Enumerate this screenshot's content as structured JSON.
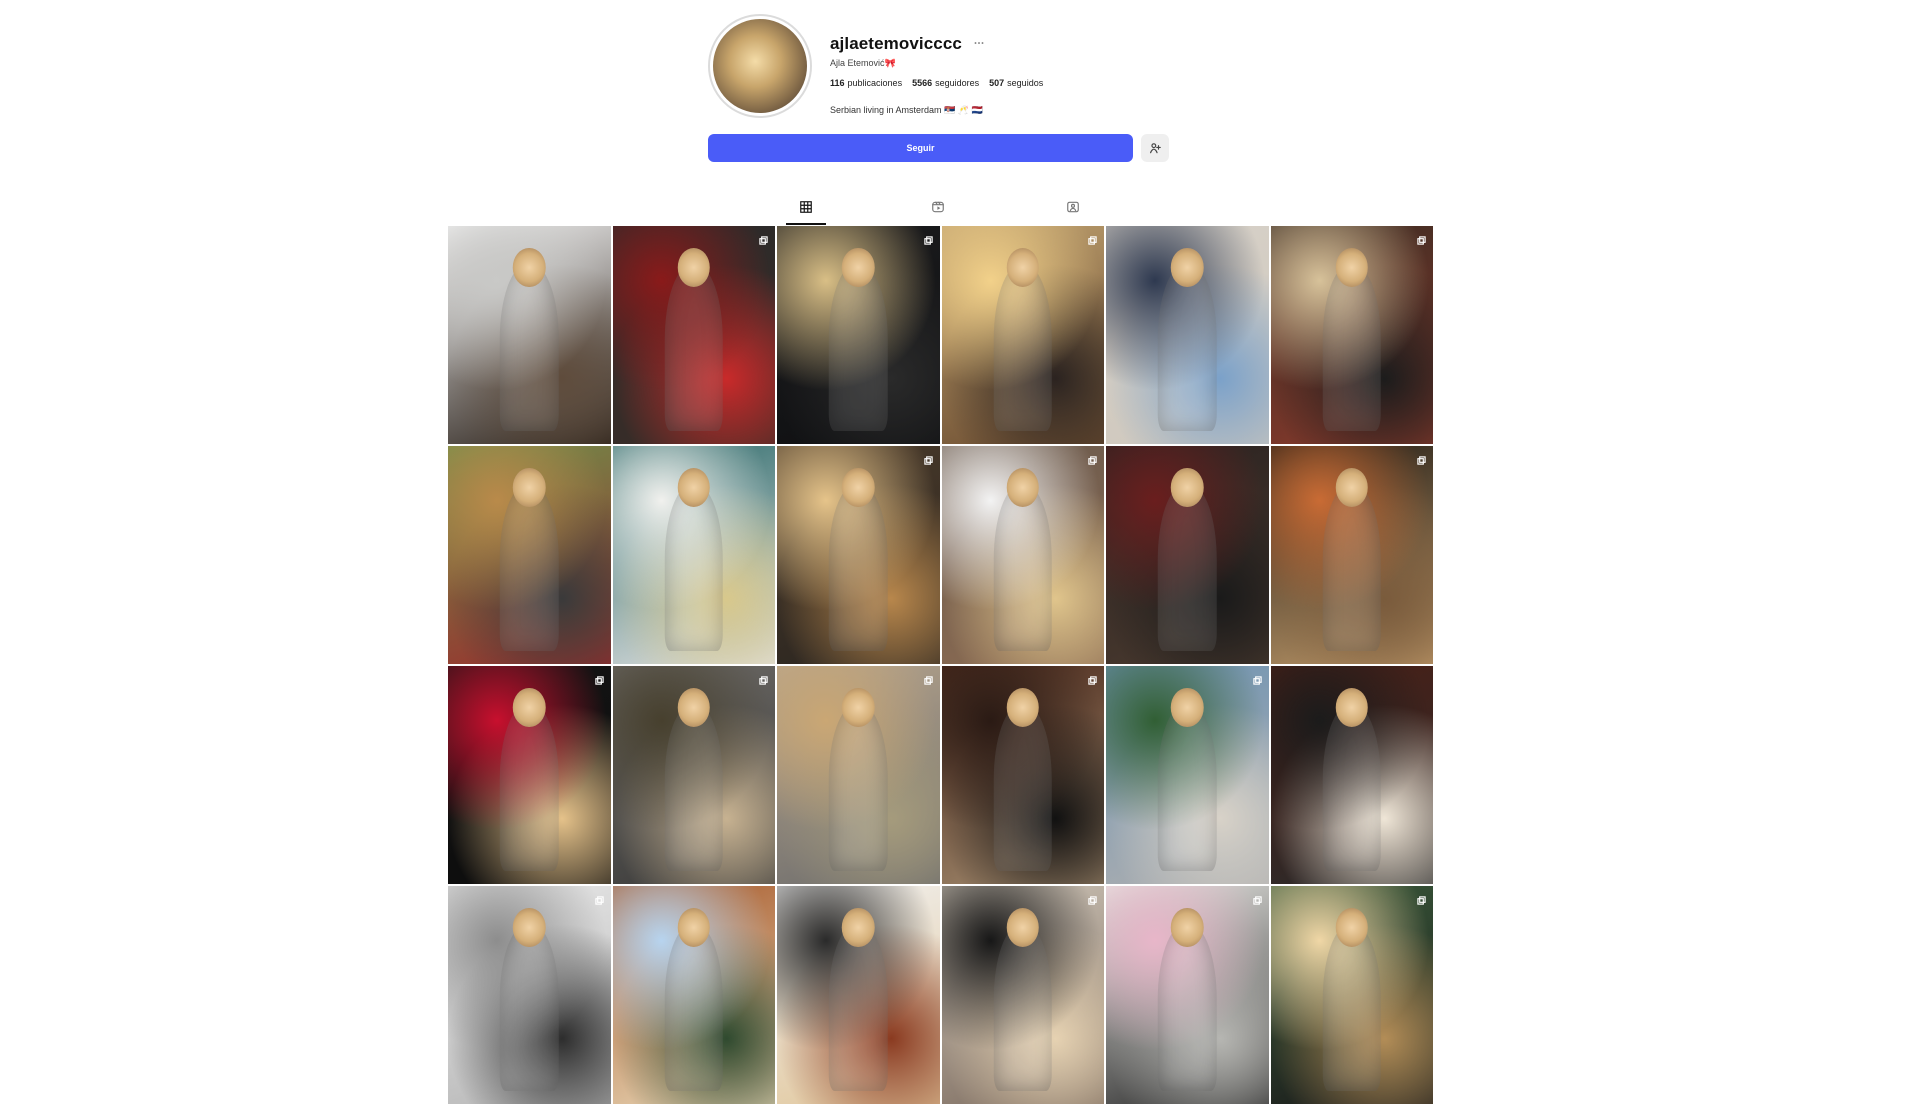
{
  "profile": {
    "username": "ajlaetemovicccc",
    "full_name": "Ajla Etemović🎀",
    "stats": [
      {
        "value": "116",
        "label": "publicaciones"
      },
      {
        "value": "5566",
        "label": "seguidores"
      },
      {
        "value": "507",
        "label": "seguidos"
      }
    ],
    "bio": "Serbian living in Amsterdam 🇷🇸 🥂 🇳🇱",
    "follow_button": "Seguir",
    "more_icon": "ellipsis-icon",
    "suggest_icon": "add-person-icon"
  },
  "tabs": [
    {
      "name": "posts",
      "icon": "grid-icon",
      "active": true
    },
    {
      "name": "reels",
      "icon": "reels-icon",
      "active": false
    },
    {
      "name": "tagged",
      "icon": "tagged-icon",
      "active": false
    }
  ],
  "grid": {
    "posts": [
      {
        "multi": false,
        "colors": [
          "#f2f2f2",
          "#c9c9c7",
          "#5f4c3c",
          "#2a211a"
        ]
      },
      {
        "multi": true,
        "colors": [
          "#2a2a2a",
          "#8a1a1a",
          "#c92a2a",
          "#3a2d27"
        ]
      },
      {
        "multi": true,
        "colors": [
          "#1b1b1d",
          "#d9bf86",
          "#2a2a2a",
          "#0f1012"
        ]
      },
      {
        "multi": true,
        "colors": [
          "#c0a270",
          "#f2d18a",
          "#2b2320",
          "#6a4b2f"
        ]
      },
      {
        "multi": false,
        "colors": [
          "#d7d1c8",
          "#2e3950",
          "#7ba1c9",
          "#cfc8bd"
        ]
      },
      {
        "multi": true,
        "colors": [
          "#3a2b22",
          "#d7c29a",
          "#1c1c1c",
          "#8a3a2c"
        ]
      },
      {
        "multi": false,
        "colors": [
          "#6f8f4a",
          "#b98a4a",
          "#3a3a3a",
          "#9b2c2c"
        ]
      },
      {
        "multi": false,
        "colors": [
          "#2d6a6a",
          "#f1f1ee",
          "#d8c88c",
          "#e2e2e2"
        ]
      },
      {
        "multi": true,
        "colors": [
          "#4a3a2a",
          "#e6c48a",
          "#b8874c",
          "#2a2520"
        ]
      },
      {
        "multi": true,
        "colors": [
          "#6b5a4d",
          "#f3f3f3",
          "#e0c58c",
          "#8b6b52"
        ]
      },
      {
        "multi": false,
        "colors": [
          "#2a2220",
          "#6a1e1e",
          "#1a1a1a",
          "#4a3a2f"
        ]
      },
      {
        "multi": true,
        "colors": [
          "#1f1a14",
          "#c96b34",
          "#7a5b3c",
          "#c09a6a"
        ]
      },
      {
        "multi": true,
        "colors": [
          "#141414",
          "#c8102e",
          "#e5c28a",
          "#0c0c0c"
        ]
      },
      {
        "multi": true,
        "colors": [
          "#6d6a66",
          "#47402e",
          "#c7b291",
          "#3a3a39"
        ]
      },
      {
        "multi": true,
        "colors": [
          "#b7a58d",
          "#caa774",
          "#a59b7c",
          "#6b6b6b"
        ]
      },
      {
        "multi": true,
        "colors": [
          "#4b2a1d",
          "#2a1a14",
          "#111111",
          "#a28a6d"
        ]
      },
      {
        "multi": true,
        "colors": [
          "#6e93b3",
          "#315f34",
          "#d8d2c8",
          "#b0b0b0"
        ]
      },
      {
        "multi": false,
        "colors": [
          "#4a1f16",
          "#1b1b1b",
          "#efe6d7",
          "#2a2a2a"
        ]
      },
      {
        "multi": true,
        "colors": [
          "#e9e9e9",
          "#8d8d8d",
          "#2d2d2d",
          "#b5b5b5"
        ]
      },
      {
        "multi": false,
        "colors": [
          "#a75a2c",
          "#b7d4ef",
          "#2f4a2f",
          "#e9d7b6"
        ]
      },
      {
        "multi": false,
        "colors": [
          "#f1f1f1",
          "#2a2a2a",
          "#8a3a20",
          "#e1c69a"
        ]
      },
      {
        "multi": true,
        "colors": [
          "#cfc6b9",
          "#171717",
          "#e6d2b2",
          "#7c6b5e"
        ]
      },
      {
        "multi": true,
        "colors": [
          "#e6e6e2",
          "#e8b6c9",
          "#b6b6b2",
          "#2a2a2a"
        ]
      },
      {
        "multi": true,
        "colors": [
          "#3a5a3a",
          "#f0d7a6",
          "#b38d57",
          "#1a1a1a"
        ]
      }
    ]
  }
}
